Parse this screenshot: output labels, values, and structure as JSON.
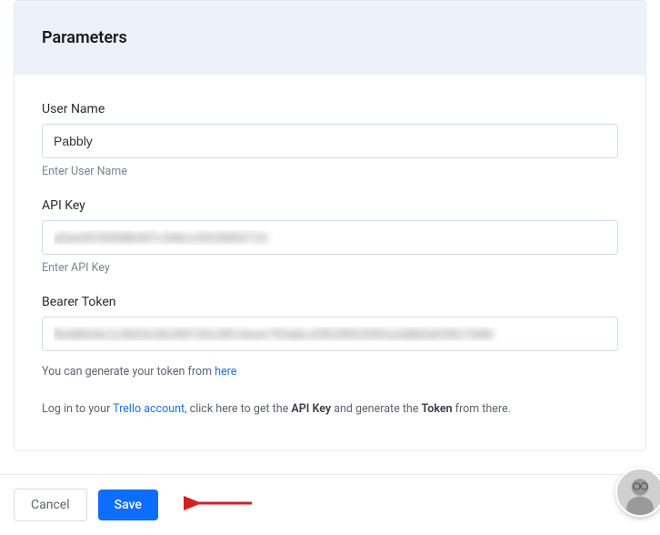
{
  "header": {
    "title": "Parameters"
  },
  "form": {
    "userName": {
      "label": "User Name",
      "value": "Pabbly",
      "hint": "Enter User Name"
    },
    "apiKey": {
      "label": "API Key",
      "value": "a0ee923056fb497c34bcc0918900715",
      "hint": "Enter API Key"
    },
    "bearerToken": {
      "label": "Bearer Token",
      "value": "fb4d604e113b93c0b296745c9814eee793abc42f0285030f2a2d8b5d20817b86"
    }
  },
  "hints": {
    "tokenPrefix": "You can generate your token from ",
    "tokenLink": "here",
    "loginPrefix": "Log in to your ",
    "trelloLink": "Trello account",
    "loginMiddle": ", click here to get the ",
    "apiKeyBold": "API Key",
    "loginMiddle2": " and generate the ",
    "tokenBold": "Token",
    "loginSuffix": " from there."
  },
  "footer": {
    "cancel": "Cancel",
    "save": "Save"
  }
}
